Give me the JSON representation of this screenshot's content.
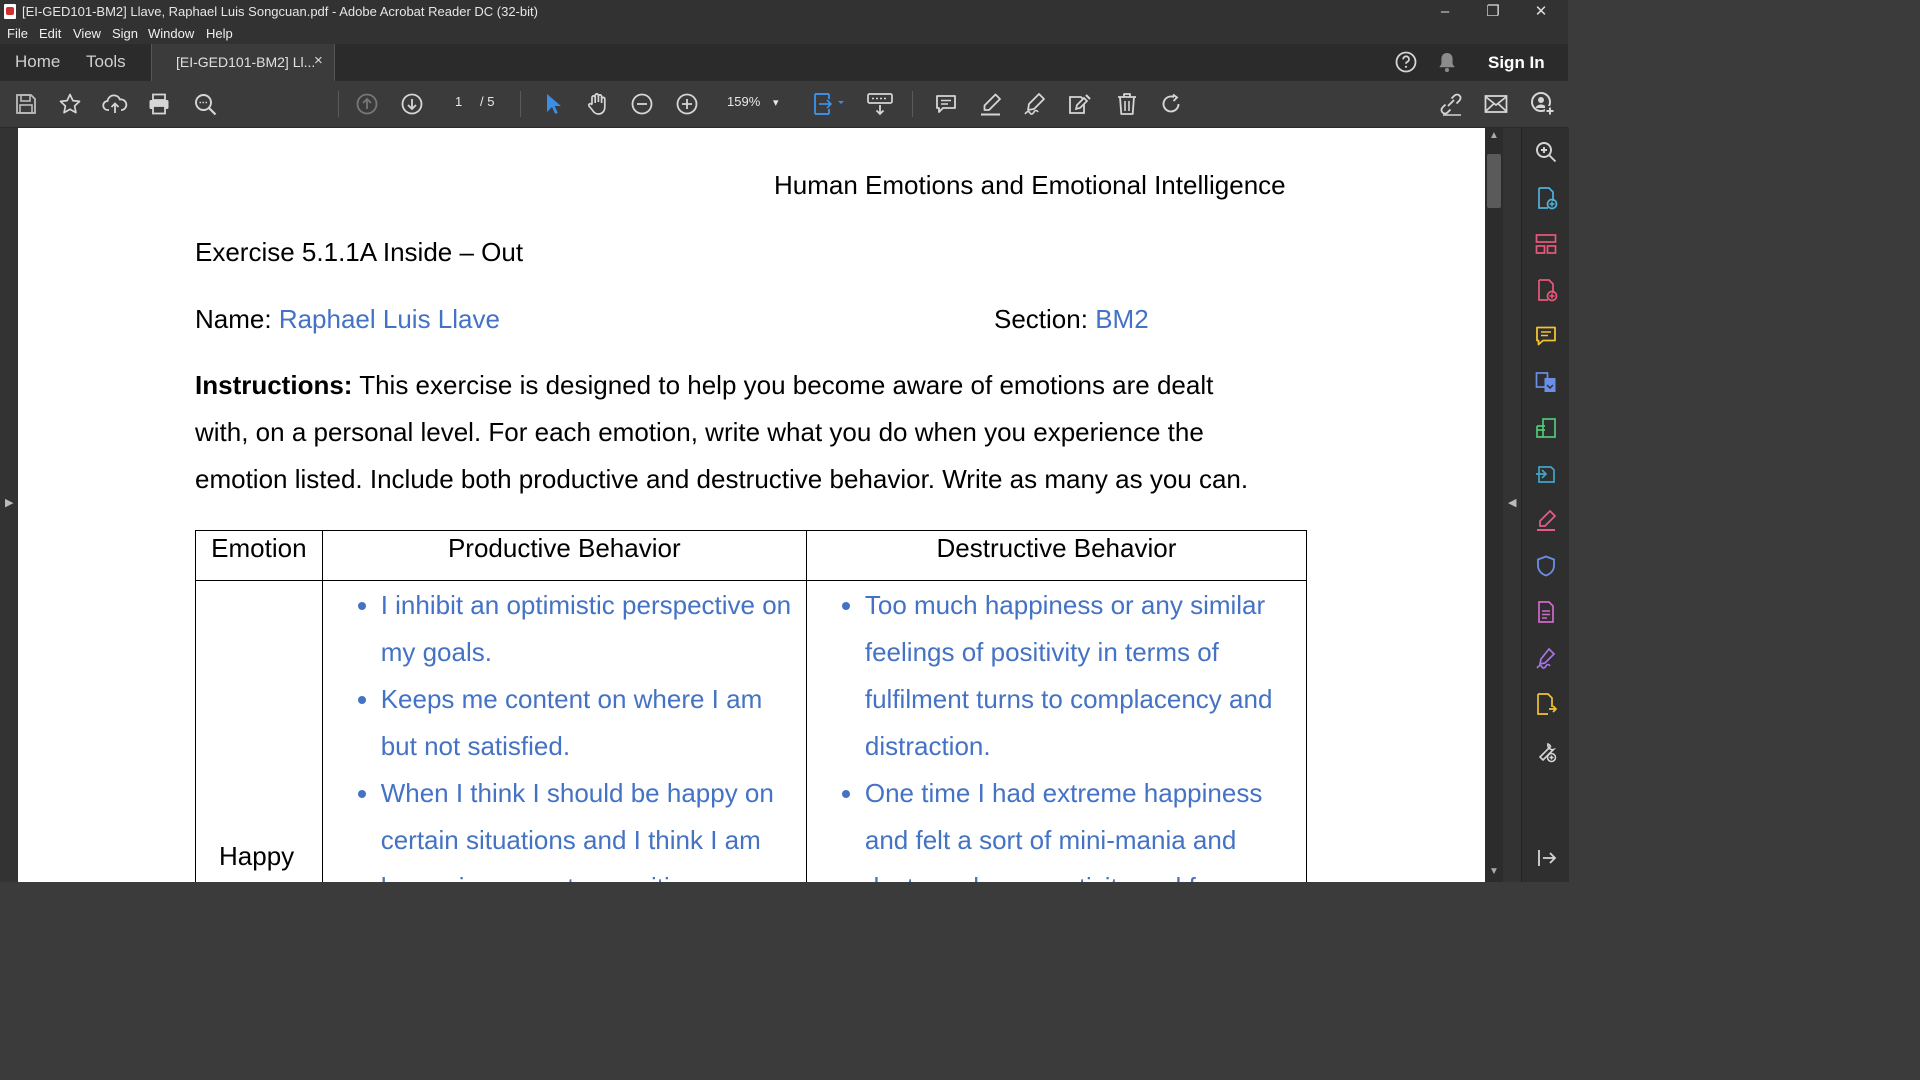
{
  "window": {
    "title": "[EI-GED101-BM2] Llave, Raphael Luis Songcuan.pdf - Adobe Acrobat Reader DC (32-bit)",
    "controls": [
      "minimize",
      "restore",
      "close"
    ]
  },
  "menubar": {
    "items": [
      "File",
      "Edit",
      "View",
      "Sign",
      "Window",
      "Help"
    ]
  },
  "tabs": {
    "home": "Home",
    "tools": "Tools",
    "document": "[EI-GED101-BM2] Ll...",
    "close_glyph": "×"
  },
  "header_right": {
    "sign_in": "Sign In"
  },
  "toolbar": {
    "page_current": "1",
    "page_total": "/ 5",
    "zoom": "159%",
    "zoom_caret": "▾"
  },
  "document": {
    "header": "Human Emotions and Emotional Intelligence",
    "exercise_title": "Exercise 5.1.1A Inside – Out",
    "name_label": "Name:",
    "name_value": "Raphael Luis Llave",
    "section_label": "Section:",
    "section_value": "BM2",
    "instructions_label": "Instructions:",
    "instructions_line1": " This exercise is designed to help you become aware of emotions are dealt",
    "instructions_line2": "with, on a personal level. For each emotion, write what you do when you experience the",
    "instructions_line3": "emotion listed. Include both productive and destructive behavior. Write as many as you can.",
    "table": {
      "headers": [
        "Emotion",
        "Productive Behavior",
        "Destructive Behavior"
      ],
      "rows": [
        {
          "emotion": "Happy",
          "productive": [
            "I inhibit an optimistic perspective on my goals.",
            "Keeps me content on where I am but not satisfied.",
            "When I think I should be happy on certain situations and I think I am happy incorporates positive"
          ],
          "destructive": [
            "Too much happiness or any similar feelings of positivity in terms of fulfilment turns to complacency and distraction.",
            "One time I had extreme happiness and felt a sort of mini-mania and destroyed my creativity and focus"
          ]
        }
      ]
    }
  },
  "colors": {
    "app_background": "#3b3b3b",
    "answer_text": "#4472c4",
    "select_tool_accent": "#3a8ee6"
  },
  "icons": {
    "toolbar_left": [
      "save-icon",
      "star-icon",
      "upload-icon",
      "print-icon",
      "search-icon"
    ],
    "toolbar_nav": [
      "prev-page-icon",
      "next-page-icon"
    ],
    "toolbar_tools": [
      "select-arrow-icon",
      "hand-icon",
      "zoom-out-icon",
      "zoom-in-icon",
      "fit-page-icon",
      "keyboard-icon"
    ],
    "toolbar_annot": [
      "comment-icon",
      "highlight-pen-icon",
      "sign-icon",
      "stamp-icon",
      "trash-icon",
      "rotate-icon"
    ],
    "toolbar_right": [
      "share-link-icon",
      "email-icon",
      "add-user-icon"
    ],
    "right_panel": [
      "zoom-icon",
      "create-pdf-icon",
      "organize-pages-icon",
      "export-pdf-icon",
      "comment-icon",
      "combine-files-icon",
      "edit-pdf-icon",
      "convert-icon",
      "fill-sign-icon",
      "protect-icon",
      "compress-icon",
      "request-signature-icon",
      "more-tools-icon",
      "tools-icon",
      "collapse-icon"
    ]
  }
}
